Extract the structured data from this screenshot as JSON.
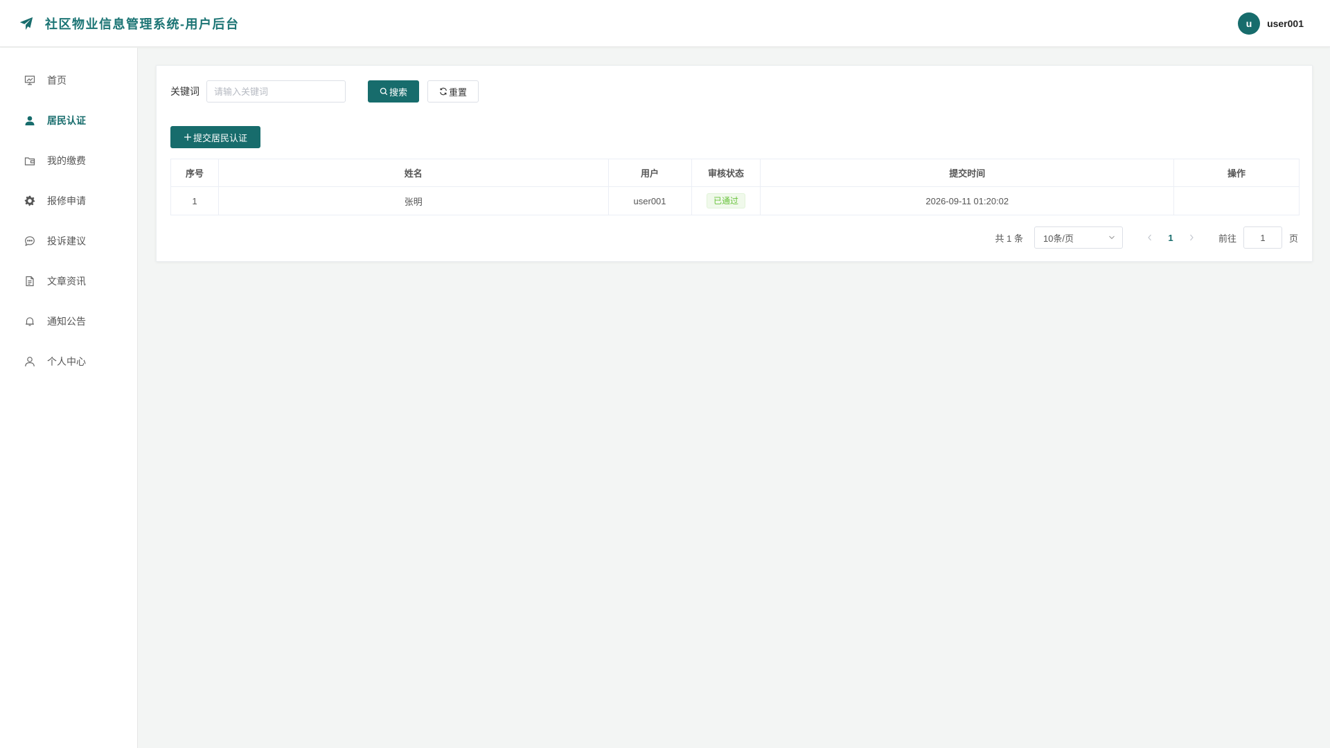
{
  "app": {
    "title": "社区物业信息管理系统-用户后台",
    "logo_icon": "paper-plane-icon",
    "accent_color": "#176c6c"
  },
  "user": {
    "avatar_letter": "u",
    "name": "user001"
  },
  "sidebar": {
    "items": [
      {
        "label": "首页",
        "icon": "presentation-board-icon",
        "active": false
      },
      {
        "label": "居民认证",
        "icon": "user-filled-icon",
        "active": true
      },
      {
        "label": "我的缴费",
        "icon": "wallet-icon",
        "active": false
      },
      {
        "label": "报修申请",
        "icon": "gear-icon",
        "active": false
      },
      {
        "label": "投诉建议",
        "icon": "chat-bubble-icon",
        "active": false
      },
      {
        "label": "文章资讯",
        "icon": "document-icon",
        "active": false
      },
      {
        "label": "通知公告",
        "icon": "bell-icon",
        "active": false
      },
      {
        "label": "个人中心",
        "icon": "user-outline-icon",
        "active": false
      }
    ]
  },
  "search": {
    "label": "关键词",
    "placeholder": "请输入关键词",
    "value": "",
    "search_button": "搜索",
    "reset_button": "重置"
  },
  "toolbar": {
    "add_button": "提交居民认证"
  },
  "table": {
    "columns": [
      "序号",
      "姓名",
      "用户",
      "审核状态",
      "提交时间",
      "操作"
    ],
    "rows": [
      {
        "index": "1",
        "name": "张明",
        "user": "user001",
        "status": "已通过",
        "submitted_at": "2026-09-11 01:20:02",
        "actions": ""
      }
    ]
  },
  "pagination": {
    "total_text": "共 1 条",
    "page_size": "10条/页",
    "current_page": "1",
    "jump_label": "前往",
    "jump_value": "1",
    "jump_suffix": "页"
  }
}
